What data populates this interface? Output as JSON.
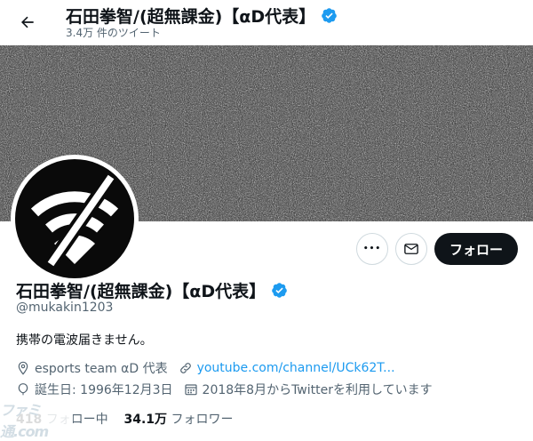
{
  "header": {
    "title": "石田拳智/(超無課金)【αD代表】",
    "tweet_count": "3.4万 件のツイート"
  },
  "profile": {
    "name": "石田拳智/(超無課金)【αD代表】",
    "handle": "@mukakin1203",
    "bio": "携帯の電波届きません。",
    "location": "esports team αD 代表",
    "website": "youtube.com/channel/UCk62T...",
    "birthday": "誕生日: 1996年12月3日",
    "joined": "2018年8月からTwitterを利用しています",
    "following_count": "418",
    "following_label": "フォロー中",
    "followers_count": "34.1万",
    "followers_label": "フォロワー"
  },
  "actions": {
    "follow_label": "フォロー",
    "more_label": "•••"
  },
  "watermark": "ファミ通.com",
  "colors": {
    "accent": "#1d9bf0",
    "text": "#0f1419",
    "secondary": "#536471"
  }
}
